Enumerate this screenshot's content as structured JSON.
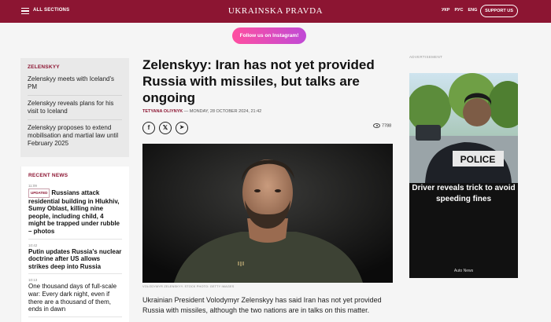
{
  "header": {
    "menu_label": "ALL SECTIONS",
    "logo": "UKRAINSKA PRAVDA",
    "languages": [
      "УКР",
      "РУС",
      "ENG"
    ],
    "support_label": "SUPPORT US",
    "bg_color": "#8c1532"
  },
  "instagram": {
    "label": "Follow us on Instagram!"
  },
  "zelenskyy_box": {
    "title": "ZELENSKYY",
    "items": [
      "Zelenskyy meets with Iceland's PM",
      "Zelenskyy reveals plans for his visit to Iceland",
      "Zelenskyy proposes to extend mobilisation and martial law until February 2025"
    ]
  },
  "recent_news": {
    "title": "RECENT NEWS",
    "items": [
      {
        "time": "11:09",
        "badge": "UPDATED",
        "title": "Russians attack residential building in Hlukhiv, Sumy Oblast, killing nine people, including child, 4 might be trapped under rubble – photos"
      },
      {
        "time": "10:42",
        "title": "Putin updates Russia's nuclear doctrine after US allows strikes deep into Russia"
      },
      {
        "time": "10:13",
        "title": "One thousand days of full-scale war: Every dark night, even if there are a thousand of them, ends in dawn"
      }
    ]
  },
  "article": {
    "headline": "Zelenskyy: Iran has not yet provided Russia with missiles, but talks are ongoing",
    "author": "TETYANA OLIYNYK",
    "date": " — MONDAY, 28 OCTOBER 2024, 21:42",
    "views": "7788",
    "share_icons": [
      "facebook-icon",
      "x-icon",
      "telegram-icon"
    ],
    "photo_caption": "VOLODYMYR ZELENSKYY. STOCK PHOTO: GETTY IMAGES",
    "lead": "Ukrainian President Volodymyr Zelenskyy has said Iran has not yet provided Russia with missiles, although the two nations are in talks on this matter."
  },
  "ad": {
    "label": "ADVERTISEMENT",
    "title": "Driver reveals trick to avoid speeding fines",
    "source": "Auto News",
    "vest_text": "POLICE"
  }
}
